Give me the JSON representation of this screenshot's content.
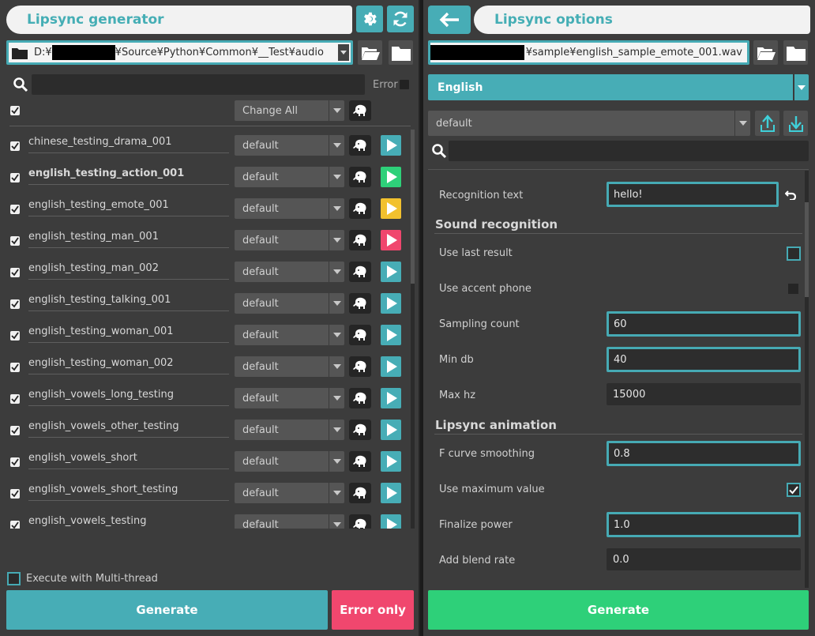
{
  "left": {
    "title": "Lipsync generator",
    "path_prefix": "D:¥",
    "path_suffix": "¥Source¥Python¥Common¥__Test¥audio",
    "error_label": "Error",
    "change_all_label": "Change All",
    "items": [
      {
        "name": "chinese_testing_drama_001",
        "preset": "default",
        "status": "teal",
        "bold": false
      },
      {
        "name": "english_testing_action_001",
        "preset": "default",
        "status": "green",
        "bold": true
      },
      {
        "name": "english_testing_emote_001",
        "preset": "default",
        "status": "yellow",
        "bold": false
      },
      {
        "name": "english_testing_man_001",
        "preset": "default",
        "status": "pink",
        "bold": false
      },
      {
        "name": "english_testing_man_002",
        "preset": "default",
        "status": "teal",
        "bold": false
      },
      {
        "name": "english_testing_talking_001",
        "preset": "default",
        "status": "teal",
        "bold": false
      },
      {
        "name": "english_testing_woman_001",
        "preset": "default",
        "status": "teal",
        "bold": false
      },
      {
        "name": "english_testing_woman_002",
        "preset": "default",
        "status": "teal",
        "bold": false
      },
      {
        "name": "english_vowels_long_testing",
        "preset": "default",
        "status": "teal",
        "bold": false
      },
      {
        "name": "english_vowels_other_testing",
        "preset": "default",
        "status": "teal",
        "bold": false
      },
      {
        "name": "english_vowels_short",
        "preset": "default",
        "status": "teal",
        "bold": false
      },
      {
        "name": "english_vowels_short_testing",
        "preset": "default",
        "status": "teal",
        "bold": false
      },
      {
        "name": "english_vowels_testing",
        "preset": "default",
        "status": "teal",
        "bold": false
      }
    ],
    "multithread_label": "Execute with Multi-thread",
    "generate_label": "Generate",
    "error_only_label": "Error only"
  },
  "right": {
    "title": "Lipsync options",
    "path_suffix": "¥sample¥english_sample_emote_001.wav",
    "language": "English",
    "preset": "default",
    "recognition_text_label": "Recognition text",
    "recognition_text_value": "hello!",
    "sound_recognition_header": "Sound recognition",
    "use_last_result_label": "Use last result",
    "use_accent_phone_label": "Use accent phone",
    "sampling_count_label": "Sampling count",
    "sampling_count_value": "60",
    "min_db_label": "Min db",
    "min_db_value": "40",
    "max_hz_label": "Max hz",
    "max_hz_value": "15000",
    "lipsync_animation_header": "Lipsync animation",
    "f_curve_label": "F curve smoothing",
    "f_curve_value": "0.8",
    "use_max_label": "Use maximum value",
    "finalize_power_label": "Finalize power",
    "finalize_power_value": "1.0",
    "add_blend_label": "Add blend rate",
    "add_blend_value": "0.0",
    "generate_label": "Generate"
  },
  "colors": {
    "accent": "#47adb6",
    "status_teal": "#47adb6",
    "status_green": "#2ed079",
    "status_yellow": "#f2c12e",
    "status_pink": "#f0476e",
    "generate_green": "#2ed079",
    "error_only": "#f0476e"
  }
}
